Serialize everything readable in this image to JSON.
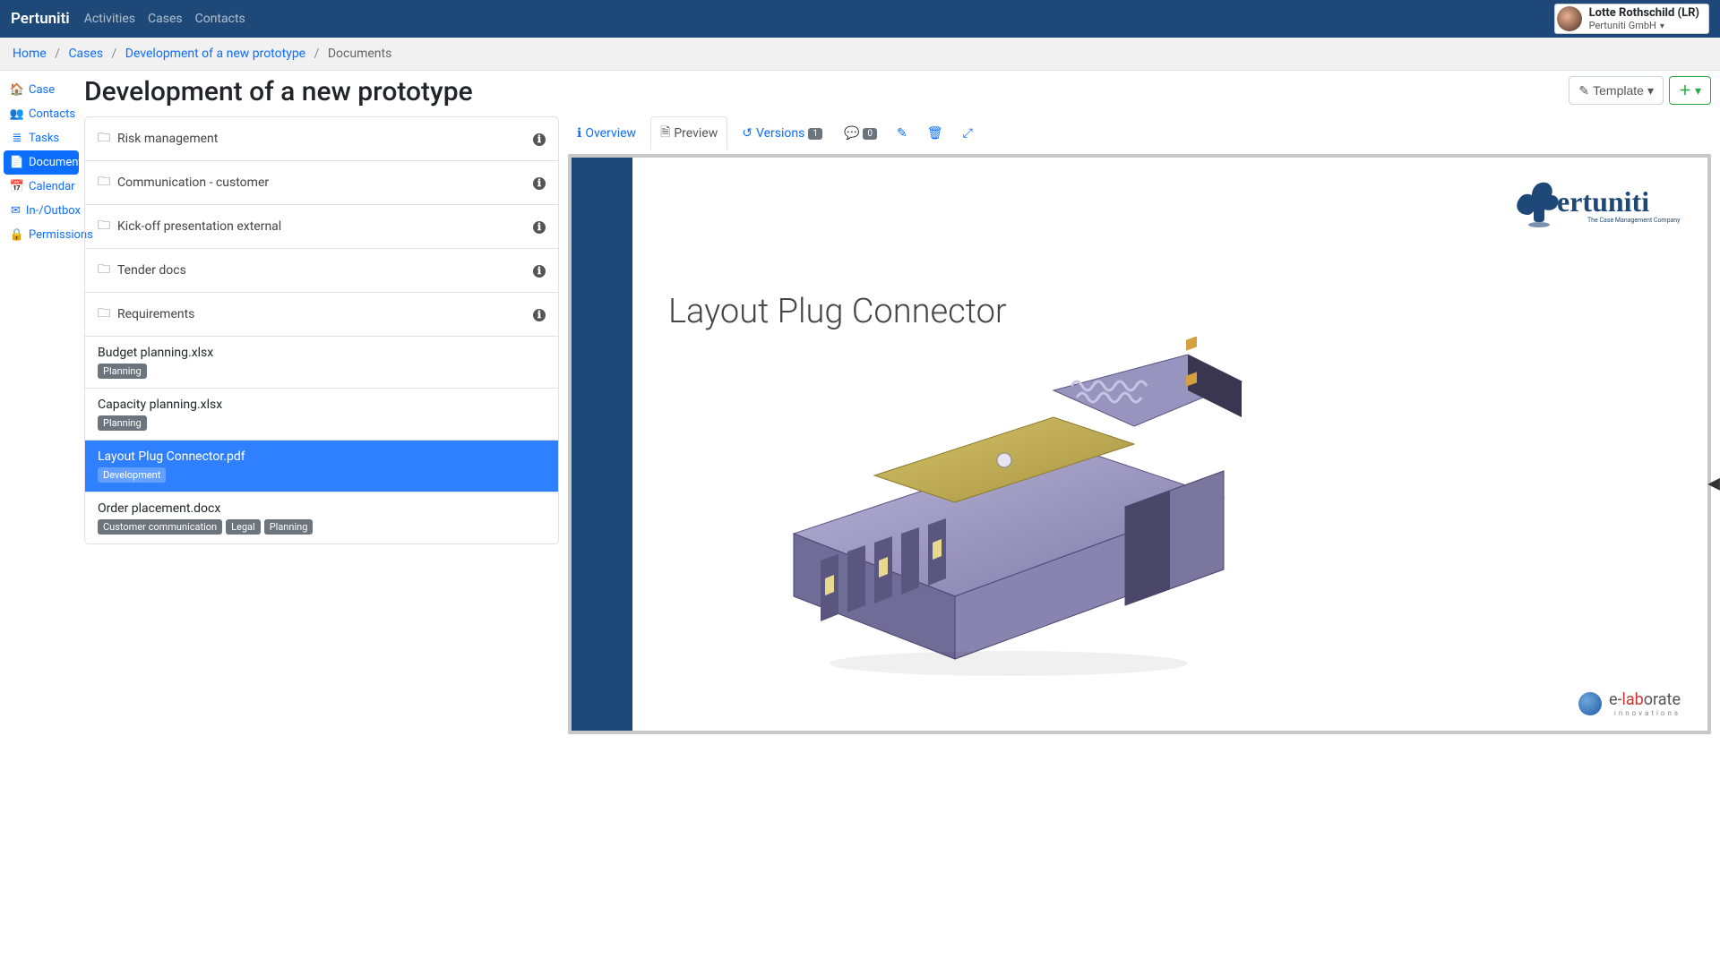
{
  "brand": "Pertuniti",
  "nav": {
    "activities": "Activities",
    "cases": "Cases",
    "contacts": "Contacts"
  },
  "user": {
    "name": "Lotte Rothschild (LR)",
    "org": "Pertuniti GmbH"
  },
  "breadcrumb": {
    "home": "Home",
    "cases": "Cases",
    "case": "Development of a new prototype",
    "current": "Documents"
  },
  "page_title": "Development of a new prototype",
  "buttons": {
    "template": "Template"
  },
  "sidenav": {
    "case": "Case",
    "contacts": "Contacts",
    "tasks": "Tasks",
    "documents": "Documents",
    "calendar": "Calendar",
    "inoutbox": "In-/Outbox",
    "permissions": "Permissions"
  },
  "folders": [
    {
      "name": "Risk management"
    },
    {
      "name": "Communication - customer"
    },
    {
      "name": "Kick-off presentation external"
    },
    {
      "name": "Tender docs"
    },
    {
      "name": "Requirements"
    }
  ],
  "files": [
    {
      "name": "Budget planning.xlsx",
      "tags": [
        "Planning"
      ],
      "selected": false
    },
    {
      "name": "Capacity planning.xlsx",
      "tags": [
        "Planning"
      ],
      "selected": false
    },
    {
      "name": "Layout Plug Connector.pdf",
      "tags": [
        "Development"
      ],
      "selected": true
    },
    {
      "name": "Order placement.docx",
      "tags": [
        "Customer communication",
        "Legal",
        "Planning"
      ],
      "selected": false
    }
  ],
  "tabs": {
    "overview": "Overview",
    "preview": "Preview",
    "versions": "Versions",
    "versions_count": "1",
    "comments_count": "0"
  },
  "doc": {
    "brand": "Pertuniti",
    "brand_tag": "The Case Management Company",
    "title": "Layout Plug Connector",
    "footer_brand_pre": "e-",
    "footer_brand_accent": "lab",
    "footer_brand_post": "orate",
    "footer_sub": "innovations"
  }
}
